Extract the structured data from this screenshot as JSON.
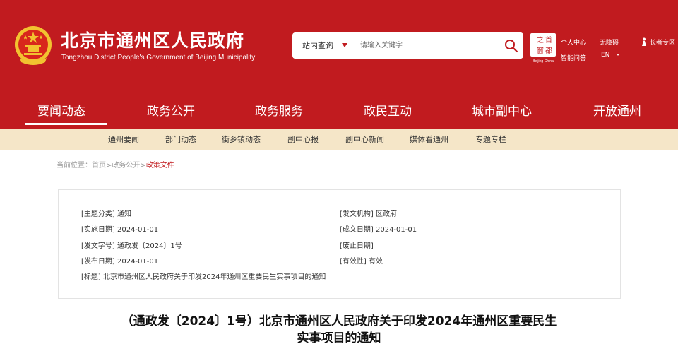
{
  "header": {
    "site_title": "北京市通州区人民政府",
    "site_subtitle": "Tongzhou District People's Government of Beijing Municipality",
    "search": {
      "scope_label": "站内查询",
      "placeholder": "请输入关键字"
    },
    "capital_logo_caption": "Beijing-China",
    "links": {
      "personal_center": "个人中心",
      "accessibility": "无障碍",
      "elder_zone": "长者专区",
      "smart_qa": "智能问答",
      "english": "EN"
    },
    "colors": {
      "primary": "#c11b1f",
      "subnav_bg": "#f5e6c8"
    }
  },
  "main_nav": [
    {
      "label": "要闻动态",
      "active": true
    },
    {
      "label": "政务公开"
    },
    {
      "label": "政务服务"
    },
    {
      "label": "政民互动"
    },
    {
      "label": "城市副中心"
    },
    {
      "label": "开放通州"
    }
  ],
  "sub_nav": [
    "通州要闻",
    "部门动态",
    "街乡镇动态",
    "副中心报",
    "副中心新闻",
    "媒体看通州",
    "专题专栏"
  ],
  "breadcrumb": {
    "prefix": "当前位置：",
    "items": [
      "首页",
      "政务公开",
      "政策文件"
    ],
    "separator": ">"
  },
  "meta": {
    "topic": "[主题分类] 通知",
    "issuer": "[发文机构] 区政府",
    "effective_date": "[实施日期] 2024-01-01",
    "written_date": "[成文日期] 2024-01-01",
    "doc_number": "[发文字号] 通政发〔2024〕1号",
    "abolish_date": "[废止日期]",
    "publish_date": "[发布日期] 2024-01-01",
    "validity": "[有效性] 有效",
    "title": "[标题] 北京市通州区人民政府关于印发2024年通州区重要民生实事项目的通知"
  },
  "document": {
    "title_line1": "（通政发〔2024〕1号）北京市通州区人民政府关于印发2024年通州区重要民生",
    "title_line2": "实事项目的通知"
  }
}
